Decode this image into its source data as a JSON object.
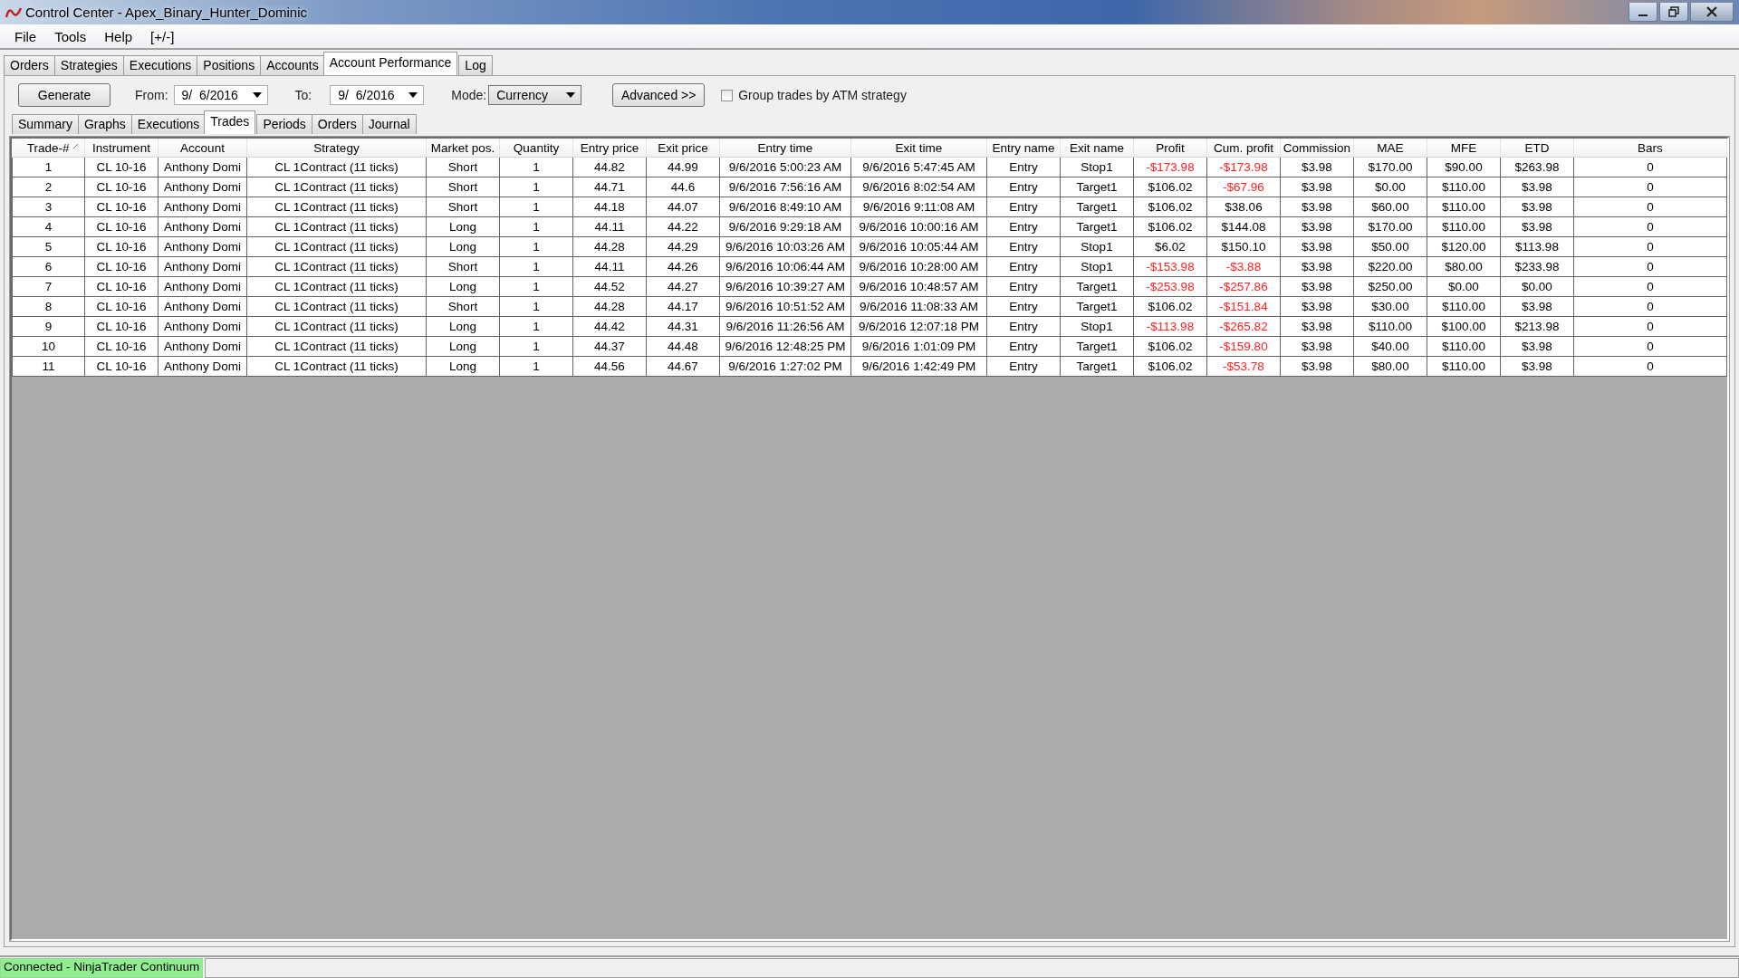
{
  "window": {
    "title": "Control Center - Apex_Binary_Hunter_Dominic"
  },
  "menu": [
    "File",
    "Tools",
    "Help",
    "[+/-]"
  ],
  "tabs": [
    {
      "label": "Orders",
      "selected": false
    },
    {
      "label": "Strategies",
      "selected": false
    },
    {
      "label": "Executions",
      "selected": false
    },
    {
      "label": "Positions",
      "selected": false
    },
    {
      "label": "Accounts",
      "selected": false
    },
    {
      "label": "Account Performance",
      "selected": true
    },
    {
      "label": "Log",
      "selected": false
    }
  ],
  "toolbar": {
    "generate_button": "Generate",
    "from_label": "From:",
    "from_date": "9/  6/2016",
    "to_label": "To:",
    "to_date": "9/  6/2016",
    "mode_label": "Mode:",
    "mode": "Currency",
    "advanced_button": "Advanced >>",
    "group_trades": {
      "label": "Group trades by ATM strategy",
      "checked": false
    }
  },
  "subtabs": [
    {
      "label": "Summary",
      "selected": false
    },
    {
      "label": "Graphs",
      "selected": false
    },
    {
      "label": "Executions",
      "selected": false
    },
    {
      "label": "Trades",
      "selected": true
    },
    {
      "label": "Periods",
      "selected": false
    },
    {
      "label": "Orders",
      "selected": false
    },
    {
      "label": "Journal",
      "selected": false
    }
  ],
  "table": {
    "columns": [
      {
        "label": "Trade-#",
        "sorted": true
      },
      {
        "label": "Instrument",
        "sorted": false
      },
      {
        "label": "Account",
        "sorted": false
      },
      {
        "label": "Strategy",
        "sorted": false
      },
      {
        "label": "Market pos.",
        "sorted": false
      },
      {
        "label": "Quantity",
        "sorted": false
      },
      {
        "label": "Entry price",
        "sorted": false
      },
      {
        "label": "Exit price",
        "sorted": false
      },
      {
        "label": "Entry time",
        "sorted": false
      },
      {
        "label": "Exit time",
        "sorted": false
      },
      {
        "label": "Entry name",
        "sorted": false
      },
      {
        "label": "Exit name",
        "sorted": false
      },
      {
        "label": "Profit",
        "sorted": false
      },
      {
        "label": "Cum. profit",
        "sorted": false
      },
      {
        "label": "Commission",
        "sorted": false
      },
      {
        "label": "MAE",
        "sorted": false
      },
      {
        "label": "MFE",
        "sorted": false
      },
      {
        "label": "ETD",
        "sorted": false
      },
      {
        "label": "Bars",
        "sorted": false
      }
    ],
    "rows": [
      {
        "cells": [
          "1",
          "CL 10-16",
          "Anthony Domi",
          "CL 1Contract (11 ticks)",
          "Short",
          "1",
          "44.82",
          "44.99",
          "9/6/2016 5:00:23 AM",
          "9/6/2016 5:47:45 AM",
          "Entry",
          "Stop1",
          "-$173.98",
          "-$173.98",
          "$3.98",
          "$170.00",
          "$90.00",
          "$263.98",
          "0"
        ],
        "profit_loss": true,
        "cum_loss": true
      },
      {
        "cells": [
          "2",
          "CL 10-16",
          "Anthony Domi",
          "CL 1Contract (11 ticks)",
          "Short",
          "1",
          "44.71",
          "44.6",
          "9/6/2016 7:56:16 AM",
          "9/6/2016 8:02:54 AM",
          "Entry",
          "Target1",
          "$106.02",
          "-$67.96",
          "$3.98",
          "$0.00",
          "$110.00",
          "$3.98",
          "0"
        ],
        "profit_loss": false,
        "cum_loss": true
      },
      {
        "cells": [
          "3",
          "CL 10-16",
          "Anthony Domi",
          "CL 1Contract (11 ticks)",
          "Short",
          "1",
          "44.18",
          "44.07",
          "9/6/2016 8:49:10 AM",
          "9/6/2016 9:11:08 AM",
          "Entry",
          "Target1",
          "$106.02",
          "$38.06",
          "$3.98",
          "$60.00",
          "$110.00",
          "$3.98",
          "0"
        ],
        "profit_loss": false,
        "cum_loss": false
      },
      {
        "cells": [
          "4",
          "CL 10-16",
          "Anthony Domi",
          "CL 1Contract (11 ticks)",
          "Long",
          "1",
          "44.11",
          "44.22",
          "9/6/2016 9:29:18 AM",
          "9/6/2016 10:00:16 AM",
          "Entry",
          "Target1",
          "$106.02",
          "$144.08",
          "$3.98",
          "$170.00",
          "$110.00",
          "$3.98",
          "0"
        ],
        "profit_loss": false,
        "cum_loss": false
      },
      {
        "cells": [
          "5",
          "CL 10-16",
          "Anthony Domi",
          "CL 1Contract (11 ticks)",
          "Long",
          "1",
          "44.28",
          "44.29",
          "9/6/2016 10:03:26 AM",
          "9/6/2016 10:05:44 AM",
          "Entry",
          "Stop1",
          "$6.02",
          "$150.10",
          "$3.98",
          "$50.00",
          "$120.00",
          "$113.98",
          "0"
        ],
        "profit_loss": false,
        "cum_loss": false
      },
      {
        "cells": [
          "6",
          "CL 10-16",
          "Anthony Domi",
          "CL 1Contract (11 ticks)",
          "Short",
          "1",
          "44.11",
          "44.26",
          "9/6/2016 10:06:44 AM",
          "9/6/2016 10:28:00 AM",
          "Entry",
          "Stop1",
          "-$153.98",
          "-$3.88",
          "$3.98",
          "$220.00",
          "$80.00",
          "$233.98",
          "0"
        ],
        "profit_loss": true,
        "cum_loss": true
      },
      {
        "cells": [
          "7",
          "CL 10-16",
          "Anthony Domi",
          "CL 1Contract (11 ticks)",
          "Long",
          "1",
          "44.52",
          "44.27",
          "9/6/2016 10:39:27 AM",
          "9/6/2016 10:48:57 AM",
          "Entry",
          "Target1",
          "-$253.98",
          "-$257.86",
          "$3.98",
          "$250.00",
          "$0.00",
          "$0.00",
          "0"
        ],
        "profit_loss": true,
        "cum_loss": true
      },
      {
        "cells": [
          "8",
          "CL 10-16",
          "Anthony Domi",
          "CL 1Contract (11 ticks)",
          "Short",
          "1",
          "44.28",
          "44.17",
          "9/6/2016 10:51:52 AM",
          "9/6/2016 11:08:33 AM",
          "Entry",
          "Target1",
          "$106.02",
          "-$151.84",
          "$3.98",
          "$30.00",
          "$110.00",
          "$3.98",
          "0"
        ],
        "profit_loss": false,
        "cum_loss": true
      },
      {
        "cells": [
          "9",
          "CL 10-16",
          "Anthony Domi",
          "CL 1Contract (11 ticks)",
          "Long",
          "1",
          "44.42",
          "44.31",
          "9/6/2016 11:26:56 AM",
          "9/6/2016 12:07:18 PM",
          "Entry",
          "Stop1",
          "-$113.98",
          "-$265.82",
          "$3.98",
          "$110.00",
          "$100.00",
          "$213.98",
          "0"
        ],
        "profit_loss": true,
        "cum_loss": true
      },
      {
        "cells": [
          "10",
          "CL 10-16",
          "Anthony Domi",
          "CL 1Contract (11 ticks)",
          "Long",
          "1",
          "44.37",
          "44.48",
          "9/6/2016 12:48:25 PM",
          "9/6/2016 1:01:09 PM",
          "Entry",
          "Target1",
          "$106.02",
          "-$159.80",
          "$3.98",
          "$40.00",
          "$110.00",
          "$3.98",
          "0"
        ],
        "profit_loss": false,
        "cum_loss": true
      },
      {
        "cells": [
          "11",
          "CL 10-16",
          "Anthony Domi",
          "CL 1Contract (11 ticks)",
          "Long",
          "1",
          "44.56",
          "44.67",
          "9/6/2016 1:27:02 PM",
          "9/6/2016 1:42:49 PM",
          "Entry",
          "Target1",
          "$106.02",
          "-$53.78",
          "$3.98",
          "$80.00",
          "$110.00",
          "$3.98",
          "0"
        ],
        "profit_loss": false,
        "cum_loss": true
      }
    ]
  },
  "status_bar": {
    "text": "Connected - NinjaTrader Continuum",
    "connected": true
  }
}
